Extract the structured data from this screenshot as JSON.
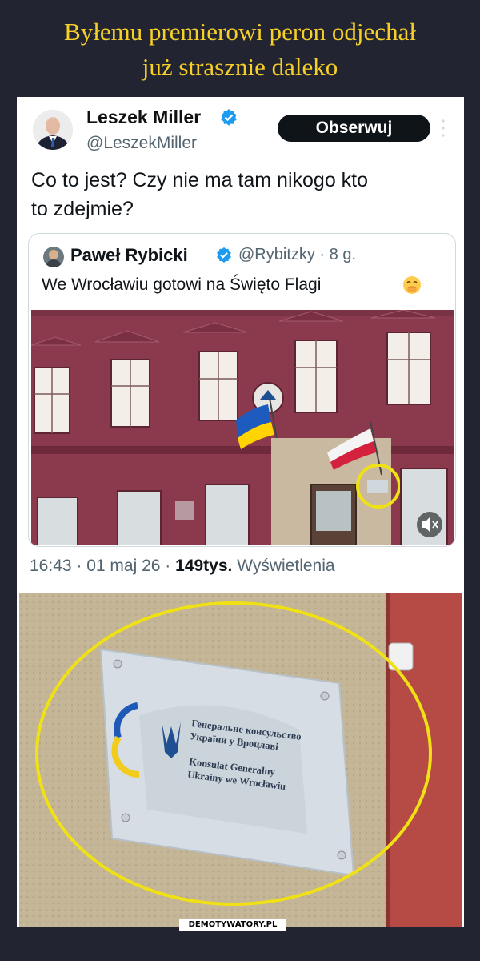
{
  "meme": {
    "title_line1": "Byłemu premierowi peron odjechał",
    "title_line2": "już strasznie daleko",
    "watermark": "DEMOTYWATORY.PL"
  },
  "tweet": {
    "author_name": "Leszek Miller",
    "author_handle": "@LeszekMiller",
    "follow_label": "Obserwuj",
    "text_line1": "Co to jest? Czy nie ma tam nikogo kto",
    "text_line2": "to zdejmie?",
    "time": "16:43",
    "date": "01 maj 26",
    "views_count": "149tys.",
    "views_label": "Wyświetlenia"
  },
  "quoted_tweet": {
    "author_name": "Paweł Rybicki",
    "author_handle": "@Rybitzky",
    "age": "8 g.",
    "text": "We Wrocławiu gotowi na Święto Flagi"
  },
  "plaque": {
    "ua_line1": "Генеральне консульство",
    "ua_line2": "України у Вроцлаві",
    "pl_line1": "Konsulat Generalny",
    "pl_line2": "Ukrainy we Wrocławiu"
  },
  "colors": {
    "title_yellow": "#f6cf28",
    "background": "#222531",
    "verified_blue": "#1d9bf0",
    "building_red": "#8b3a4e",
    "highlight_yellow": "#f0e114"
  }
}
